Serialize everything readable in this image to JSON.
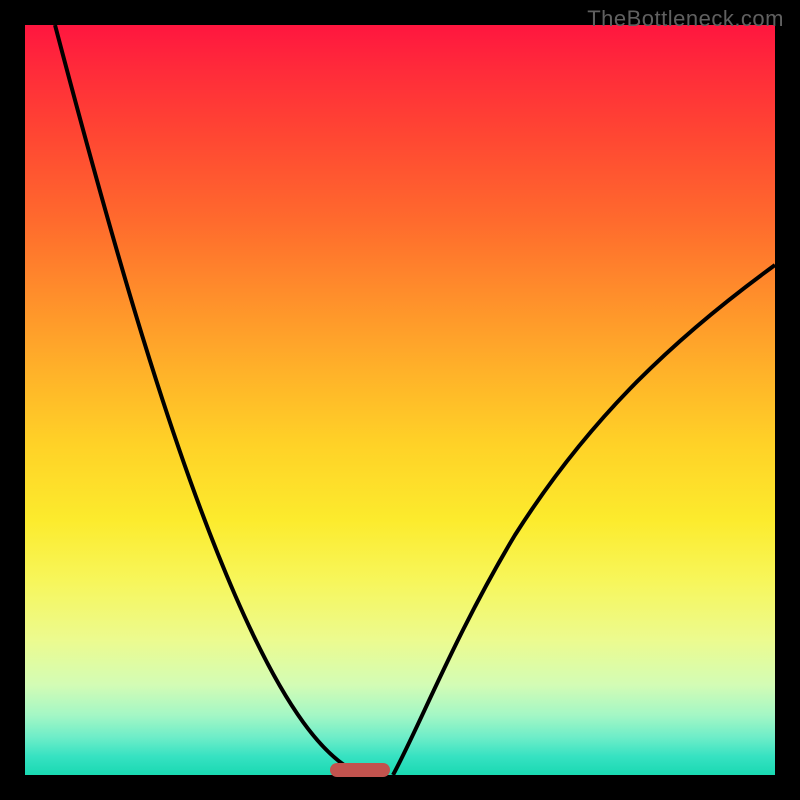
{
  "watermark": "TheBottleneck.com",
  "chart_data": {
    "type": "line",
    "title": "",
    "xlabel": "",
    "ylabel": "",
    "xlim": [
      0,
      100
    ],
    "ylim": [
      0,
      100
    ],
    "grid": false,
    "legend": false,
    "series": [
      {
        "name": "left-curve",
        "x": [
          4,
          10,
          15,
          20,
          25,
          30,
          35,
          38,
          41,
          43,
          45
        ],
        "values": [
          100,
          78,
          62,
          48,
          36,
          25,
          15,
          9,
          4,
          1.5,
          0
        ]
      },
      {
        "name": "right-curve",
        "x": [
          49,
          52,
          56,
          60,
          65,
          70,
          75,
          80,
          85,
          90,
          95,
          100
        ],
        "values": [
          0,
          5,
          12,
          19,
          27,
          34,
          41,
          47,
          53,
          58,
          63,
          68
        ]
      }
    ],
    "marker": {
      "x_center": 44.5,
      "width_pct": 8,
      "color": "#c1534e"
    },
    "gradient_stops": [
      {
        "pos": 0,
        "color": "#ff163f"
      },
      {
        "pos": 50,
        "color": "#ffc028"
      },
      {
        "pos": 75,
        "color": "#f7f65a"
      },
      {
        "pos": 100,
        "color": "#19d9b2"
      }
    ]
  }
}
